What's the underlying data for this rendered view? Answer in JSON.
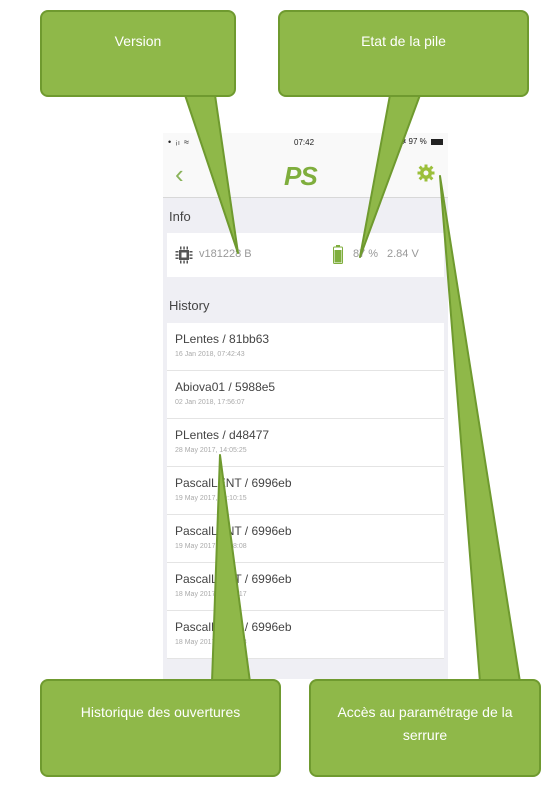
{
  "callouts": {
    "version": "Version",
    "battery": "Etat de la pile",
    "history": "Historique des ouvertures",
    "settings": "Accès au paramétrage de la serrure"
  },
  "status_bar": {
    "left": "• ᵢₗ ≈",
    "time": "07:42",
    "right": "⊲ ✱ 97 %"
  },
  "navbar": {
    "back": "‹",
    "logo": "PS",
    "settings_icon": "gear-icon"
  },
  "info": {
    "header": "Info",
    "version": "v181228 B",
    "battery_percent": "87 %",
    "battery_voltage": "2.84 V"
  },
  "history": {
    "header": "History",
    "items": [
      {
        "title": "PLentes / 81bb63",
        "date": "16 Jan 2018, 07:42:43"
      },
      {
        "title": "Abiova01 / 5988e5",
        "date": "02 Jan 2018, 17:56:07"
      },
      {
        "title": "PLentes / d48477",
        "date": "28 May 2017, 14:05:25"
      },
      {
        "title": "PascalLENT / 6996eb",
        "date": "19 May 2017, 09:10:15"
      },
      {
        "title": "PascalLENT / 6996eb",
        "date": "19 May 2017, 09:08:08"
      },
      {
        "title": "PascalLENT / 6996eb",
        "date": "18 May 2017, 16:47:17"
      },
      {
        "title": "PascalLENT / 6996eb",
        "date": "18 May 2017, 16:41:53"
      }
    ]
  },
  "colors": {
    "callout_fill": "#8fb849",
    "callout_border": "#6f9a2f",
    "accent_green": "#7fae3d"
  }
}
